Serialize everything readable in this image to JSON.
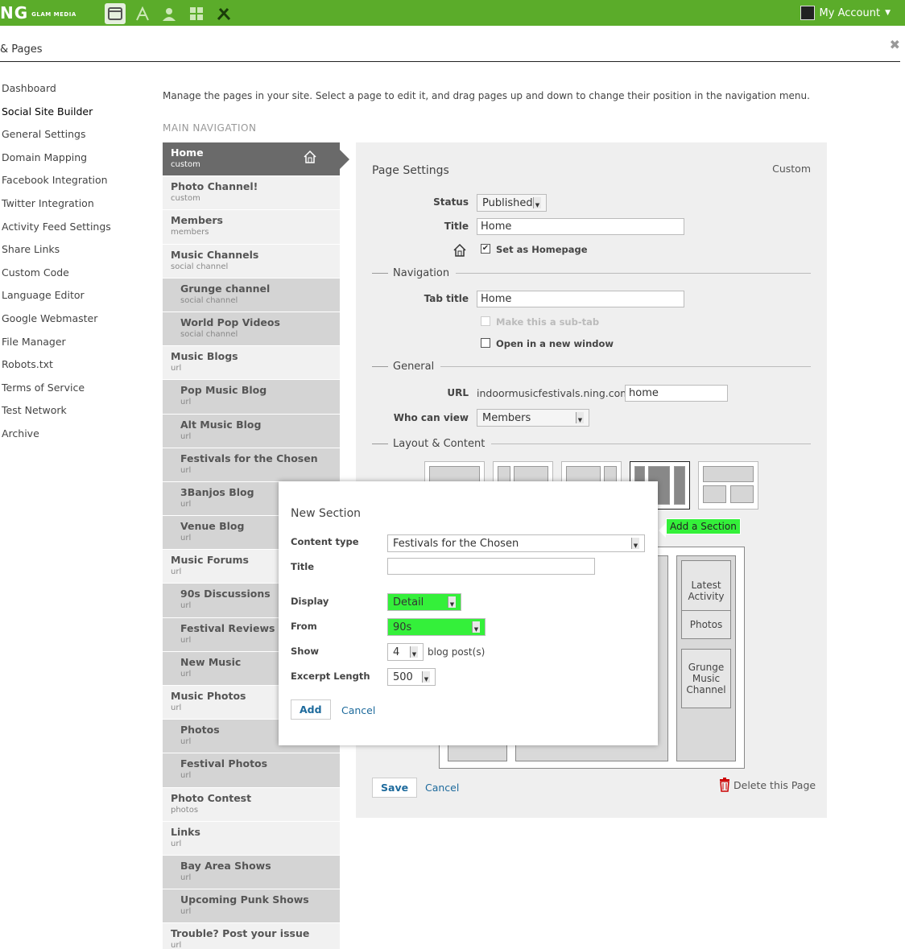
{
  "topbar": {
    "logo": "NG",
    "logo_sub": "GLAM MEDIA",
    "icons": [
      "browser-icon",
      "appearance-icon",
      "members-icon",
      "grid-icon",
      "tools-icon"
    ],
    "account_label": "My Account"
  },
  "subheader": {
    "title": "& Pages"
  },
  "sidenav": {
    "items": [
      "Dashboard",
      "Social Site Builder",
      "General Settings",
      "Domain Mapping",
      "Facebook Integration",
      "Twitter Integration",
      "Activity Feed Settings",
      "Share Links",
      "Custom Code",
      "Language Editor",
      "Google Webmaster",
      "File Manager",
      "Robots.txt",
      "Terms of Service",
      "Test Network",
      "Archive"
    ],
    "active": "Social Site Builder"
  },
  "main": {
    "intro": "Manage the pages in your site. Select a page to edit it, and drag pages up and down to change their position in the navigation menu.",
    "nav_heading": "MAIN NAVIGATION",
    "pages": [
      {
        "name": "Home",
        "type": "custom",
        "sub": false,
        "selected": true
      },
      {
        "name": "Photo Channel!",
        "type": "custom",
        "sub": false
      },
      {
        "name": "Members",
        "type": "members",
        "sub": false
      },
      {
        "name": "Music Channels",
        "type": "social channel",
        "sub": false
      },
      {
        "name": "Grunge channel",
        "type": "social channel",
        "sub": true
      },
      {
        "name": "World Pop Videos",
        "type": "social channel",
        "sub": true
      },
      {
        "name": "Music Blogs",
        "type": "url",
        "sub": false
      },
      {
        "name": "Pop Music Blog",
        "type": "url",
        "sub": true
      },
      {
        "name": "Alt Music Blog",
        "type": "url",
        "sub": true
      },
      {
        "name": "Festivals for the Chosen",
        "type": "url",
        "sub": true
      },
      {
        "name": "3Banjos Blog",
        "type": "url",
        "sub": true
      },
      {
        "name": "Venue Blog",
        "type": "url",
        "sub": true
      },
      {
        "name": "Music Forums",
        "type": "url",
        "sub": false
      },
      {
        "name": "90s Discussions",
        "type": "url",
        "sub": true
      },
      {
        "name": "Festival Reviews",
        "type": "url",
        "sub": true
      },
      {
        "name": "New Music",
        "type": "url",
        "sub": true
      },
      {
        "name": "Music Photos",
        "type": "url",
        "sub": false
      },
      {
        "name": "Photos",
        "type": "url",
        "sub": true
      },
      {
        "name": "Festival Photos",
        "type": "url",
        "sub": true
      },
      {
        "name": "Photo Contest",
        "type": "photos",
        "sub": false
      },
      {
        "name": "Links",
        "type": "url",
        "sub": false
      },
      {
        "name": "Bay Area Shows",
        "type": "url",
        "sub": true
      },
      {
        "name": "Upcoming Punk Shows",
        "type": "url",
        "sub": true
      },
      {
        "name": "Trouble? Post your issue",
        "type": "url",
        "sub": false
      }
    ]
  },
  "settings": {
    "title": "Page Settings",
    "type_label": "Custom",
    "status_label": "Status",
    "status_value": "Published",
    "title_label": "Title",
    "title_value": "Home",
    "homepage_label": "Set as Homepage",
    "navigation_heading": "Navigation",
    "tab_title_label": "Tab title",
    "tab_title_value": "Home",
    "subtab_label": "Make this a sub-tab",
    "new_window_label": "Open in a new window",
    "general_heading": "General",
    "url_label": "URL",
    "url_prefix": "indoormusicfestivals.ning.com/",
    "url_value": "home",
    "who_label": "Who can view",
    "who_value": "Members",
    "layout_heading": "Layout & Content",
    "add_section": "Add a Section",
    "widgets": [
      "Latest Activity",
      "Photos",
      "Grunge Music Channel"
    ],
    "save": "Save",
    "cancel": "Cancel",
    "delete": "Delete this Page"
  },
  "modal": {
    "title": "New Section",
    "content_type_label": "Content type",
    "content_type_value": "Festivals for the Chosen",
    "title_label": "Title",
    "title_value": "",
    "display_label": "Display",
    "display_value": "Detail",
    "from_label": "From",
    "from_value": "90s",
    "show_label": "Show",
    "show_value": "4",
    "show_suffix": "blog post(s)",
    "excerpt_label": "Excerpt Length",
    "excerpt_value": "500",
    "add": "Add",
    "cancel": "Cancel"
  },
  "colors": {
    "topbar": "#5bac2a",
    "highlight": "#34f03a",
    "link": "#1d6a9c"
  }
}
